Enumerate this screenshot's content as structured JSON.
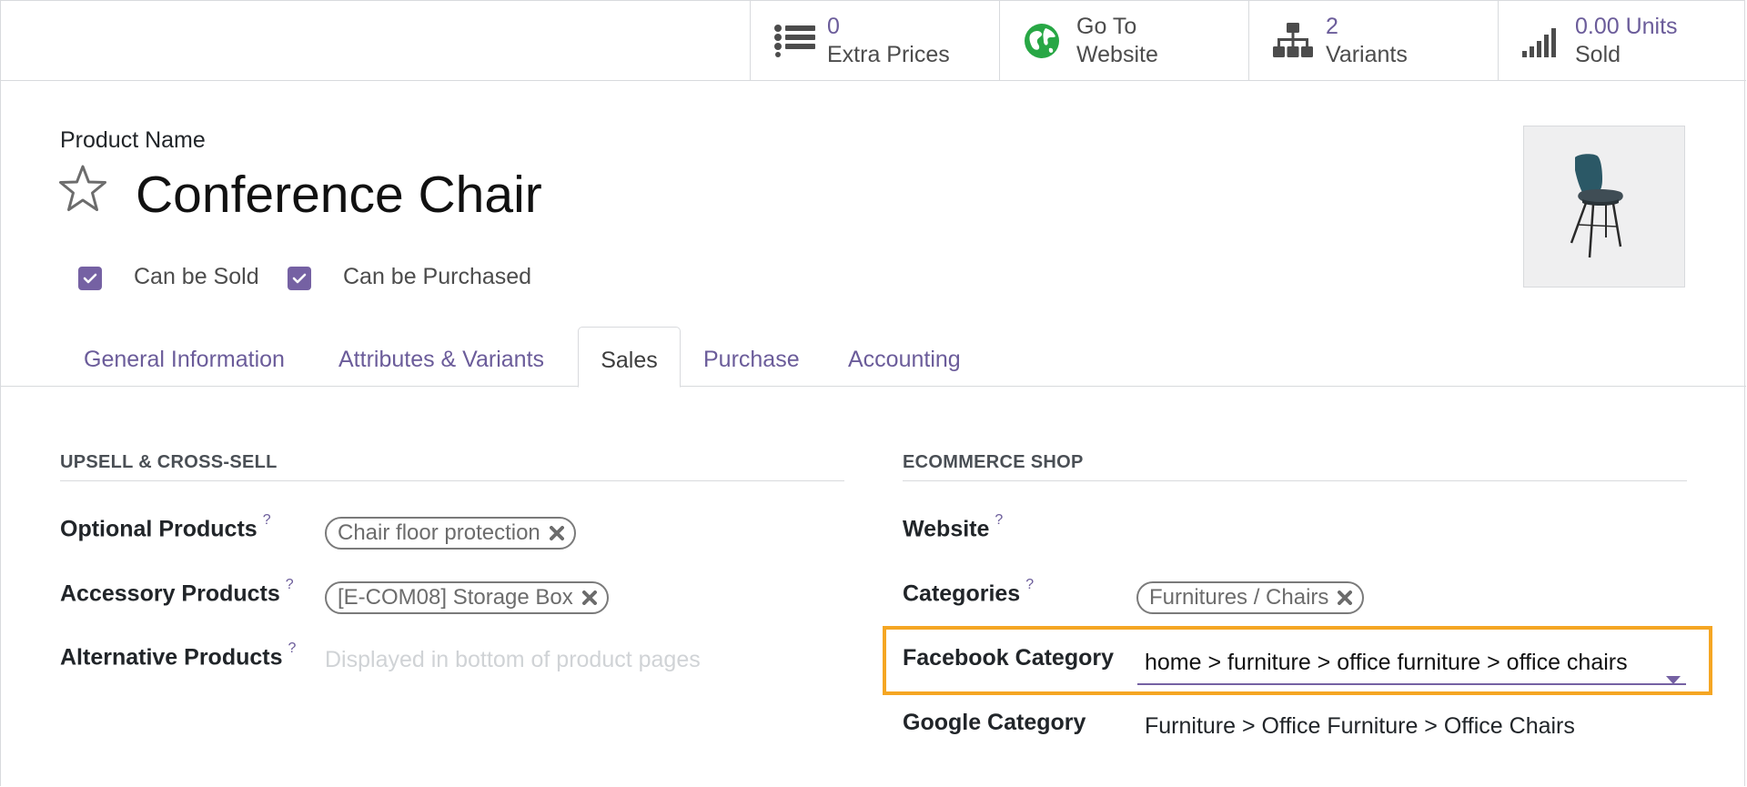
{
  "stat_buttons": [
    {
      "value": "0",
      "label": "Extra Prices",
      "icon": "list-icon"
    },
    {
      "line1": "Go To",
      "line2": "Website",
      "icon": "globe-icon"
    },
    {
      "value": "2",
      "label": "Variants",
      "icon": "sitemap-icon"
    },
    {
      "value": "0.00 Units",
      "label": "Sold",
      "icon": "signal-bars-icon"
    }
  ],
  "product": {
    "name_label": "Product Name",
    "name": "Conference Chair",
    "can_be_sold_label": "Can be Sold",
    "can_be_sold": true,
    "can_be_purchased_label": "Can be Purchased",
    "can_be_purchased": true,
    "image_icon": "chair-image"
  },
  "tabs": [
    {
      "label": "General Information",
      "active": false
    },
    {
      "label": "Attributes & Variants",
      "active": false
    },
    {
      "label": "Sales",
      "active": true
    },
    {
      "label": "Purchase",
      "active": false
    },
    {
      "label": "Accounting",
      "active": false
    }
  ],
  "upsell": {
    "title": "UPSELL & CROSS-SELL",
    "optional_label": "Optional Products",
    "optional_tags": [
      "Chair floor protection"
    ],
    "accessory_label": "Accessory Products",
    "accessory_tags": [
      "[E-COM08] Storage Box"
    ],
    "alternative_label": "Alternative Products",
    "alternative_placeholder": "Displayed in bottom of product pages",
    "help_mark": "?"
  },
  "ecommerce": {
    "title": "ECOMMERCE SHOP",
    "website_label": "Website",
    "categories_label": "Categories",
    "categories_tags": [
      "Furnitures / Chairs"
    ],
    "facebook_label": "Facebook Category",
    "facebook_value": "home > furniture > office furniture > office chairs",
    "google_label": "Google Category",
    "google_value": "Furniture > Office Furniture > Office Chairs",
    "help_mark": "?"
  },
  "colors": {
    "accent": "#7561a3",
    "highlight": "#f5a623",
    "link": "#6b5c9a"
  }
}
